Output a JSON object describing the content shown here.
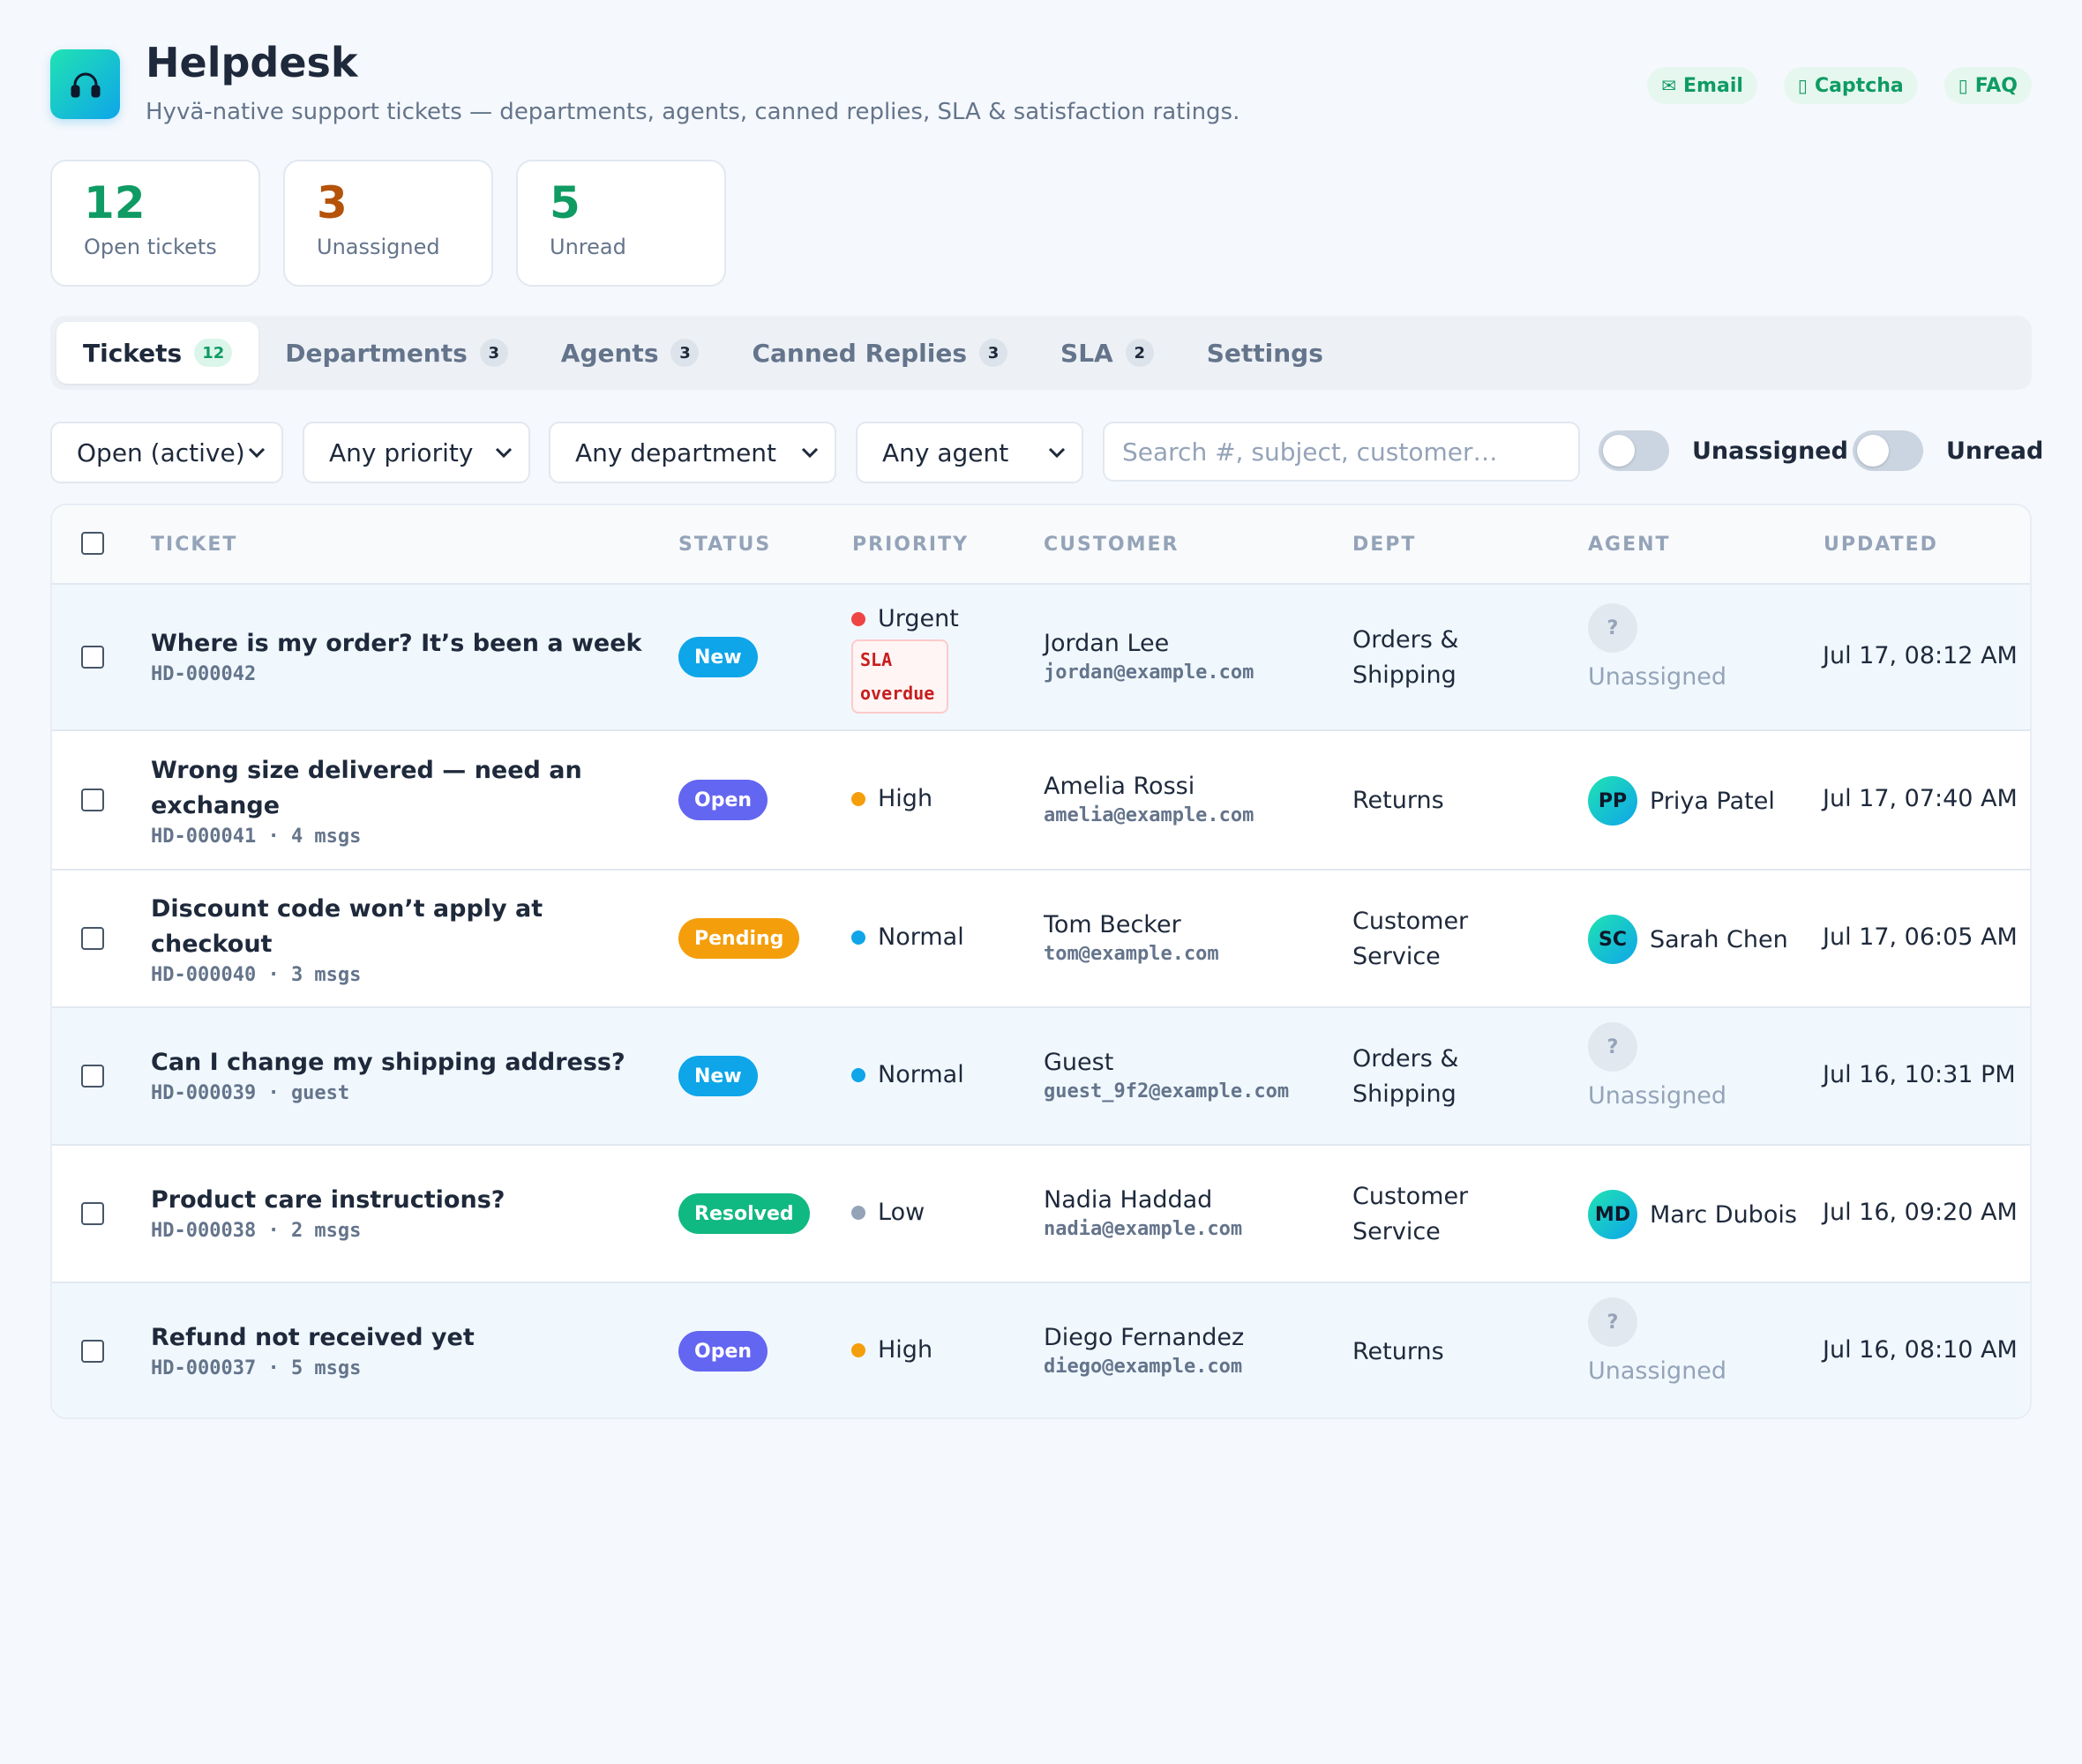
{
  "app": {
    "title": "Helpdesk",
    "subtitle": "Hyvä-native support tickets — departments, agents, canned replies, SLA & satisfaction ratings.",
    "logo_icon": "headset-icon"
  },
  "header_pills": [
    {
      "icon": "✉",
      "label": "Email"
    },
    {
      "icon": "▯",
      "label": "Captcha"
    },
    {
      "icon": "▯",
      "label": "FAQ"
    }
  ],
  "stats": [
    {
      "value": "12",
      "label": "Open tickets",
      "color": "#0f9b63"
    },
    {
      "value": "3",
      "label": "Unassigned",
      "color": "#b45309"
    },
    {
      "value": "5",
      "label": "Unread",
      "color": "#0f9b63"
    }
  ],
  "tabs": [
    {
      "label": "Tickets",
      "count": "12"
    },
    {
      "label": "Departments",
      "count": "3"
    },
    {
      "label": "Agents",
      "count": "3"
    },
    {
      "label": "Canned Replies",
      "count": "3"
    },
    {
      "label": "SLA",
      "count": "2"
    },
    {
      "label": "Settings",
      "count": ""
    }
  ],
  "filters": {
    "status": "Open (active)",
    "priority": "Any priority",
    "department": "Any department",
    "agent": "Any agent",
    "search_placeholder": "Search #, subject, customer…",
    "search_value": "",
    "toggle_unassigned": "Unassigned",
    "toggle_unread": "Unread"
  },
  "table": {
    "columns": [
      "TICKET",
      "STATUS",
      "PRIORITY",
      "CUSTOMER",
      "DEPT",
      "AGENT",
      "UPDATED"
    ],
    "rows": [
      {
        "subject": "Where is my order? It’s been a week",
        "meta": "HD-000042",
        "status": "New",
        "status_color": "#0ea5e9",
        "priority": "Urgent",
        "priority_color": "#ef4444",
        "sla": "SLA overdue",
        "customer": "Jordan Lee",
        "email": "jordan@example.com",
        "dept": "Orders & Shipping",
        "agent_initials": "?",
        "agent": "Unassigned",
        "updated": "Jul 17, 08:12 AM",
        "highlight": true
      },
      {
        "subject": "Wrong size delivered — need an exchange",
        "meta": "HD-000041 · 4 msgs",
        "status": "Open",
        "status_color": "#6366f1",
        "priority": "High",
        "priority_color": "#f59e0b",
        "sla": "",
        "customer": "Amelia Rossi",
        "email": "amelia@example.com",
        "dept": "Returns",
        "agent_initials": "PP",
        "agent": "Priya Patel",
        "updated": "Jul 17, 07:40 AM",
        "highlight": false
      },
      {
        "subject": "Discount code won’t apply at checkout",
        "meta": "HD-000040 · 3 msgs",
        "status": "Pending",
        "status_color": "#f59e0b",
        "priority": "Normal",
        "priority_color": "#0ea5e9",
        "sla": "",
        "customer": "Tom Becker",
        "email": "tom@example.com",
        "dept": "Customer Service",
        "agent_initials": "SC",
        "agent": "Sarah Chen",
        "updated": "Jul 17, 06:05 AM",
        "highlight": false
      },
      {
        "subject": "Can I change my shipping address?",
        "meta": "HD-000039 · guest",
        "status": "New",
        "status_color": "#0ea5e9",
        "priority": "Normal",
        "priority_color": "#0ea5e9",
        "sla": "",
        "customer": "Guest",
        "email": "guest_9f2@example.com",
        "dept": "Orders & Shipping",
        "agent_initials": "?",
        "agent": "Unassigned",
        "updated": "Jul 16, 10:31 PM",
        "highlight": true
      },
      {
        "subject": "Product care instructions?",
        "meta": "HD-000038 · 2 msgs",
        "status": "Resolved",
        "status_color": "#10b981",
        "priority": "Low",
        "priority_color": "#94a3b8",
        "sla": "",
        "customer": "Nadia Haddad",
        "email": "nadia@example.com",
        "dept": "Customer Service",
        "agent_initials": "MD",
        "agent": "Marc Dubois",
        "updated": "Jul 16, 09:20 AM",
        "highlight": false
      },
      {
        "subject": "Refund not received yet",
        "meta": "HD-000037 · 5 msgs",
        "status": "Open",
        "status_color": "#6366f1",
        "priority": "High",
        "priority_color": "#f59e0b",
        "sla": "",
        "customer": "Diego Fernandez",
        "email": "diego@example.com",
        "dept": "Returns",
        "agent_initials": "?",
        "agent": "Unassigned",
        "updated": "Jul 16, 08:10 AM",
        "highlight": true
      }
    ]
  }
}
